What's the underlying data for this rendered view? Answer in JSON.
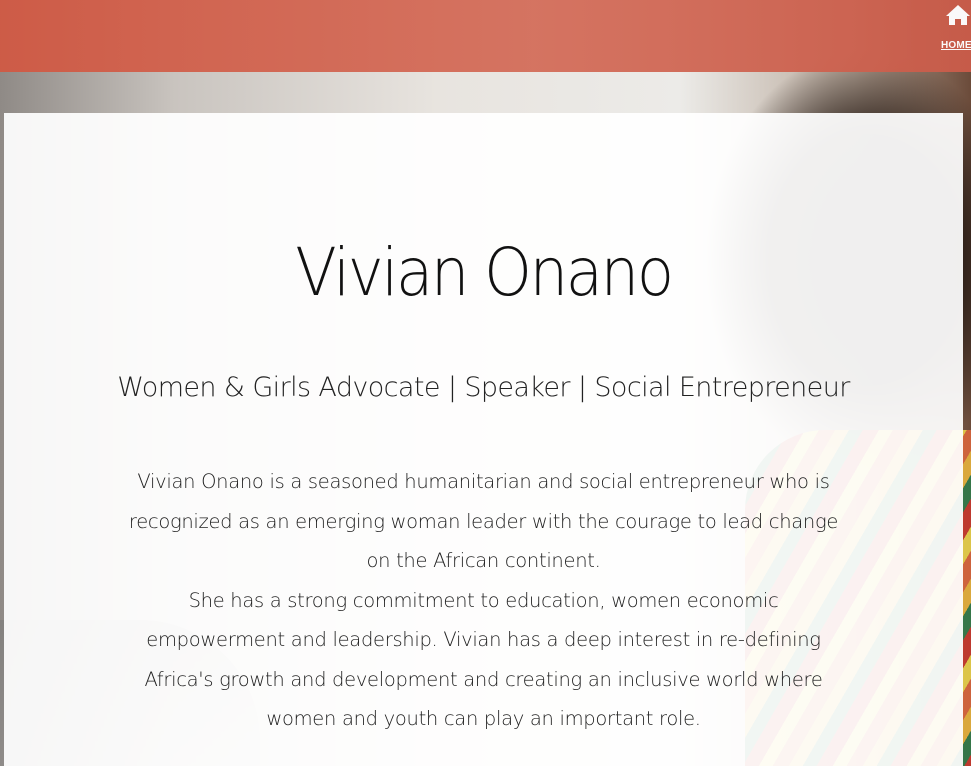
{
  "nav": {
    "home_label": "HOME"
  },
  "hero": {
    "title": "Vivian Onano",
    "tagline": "Women & Girls Advocate | Speaker | Social Entrepreneur",
    "bio_paragraph_1": "Vivian Onano is a seasoned humanitarian and social entrepreneur who is recognized as an emerging woman leader with the courage to lead change on the African continent.",
    "bio_paragraph_2": "She has a strong commitment to education, women economic empowerment and leadership. Vivian has a deep interest in re-defining Africa's growth and development and creating an inclusive world where women and youth can play an important role."
  },
  "colors": {
    "header_bar": "#cf5a45",
    "card_background": "#ffffff",
    "text": "#111111"
  },
  "icons": {
    "home": "home-icon"
  }
}
